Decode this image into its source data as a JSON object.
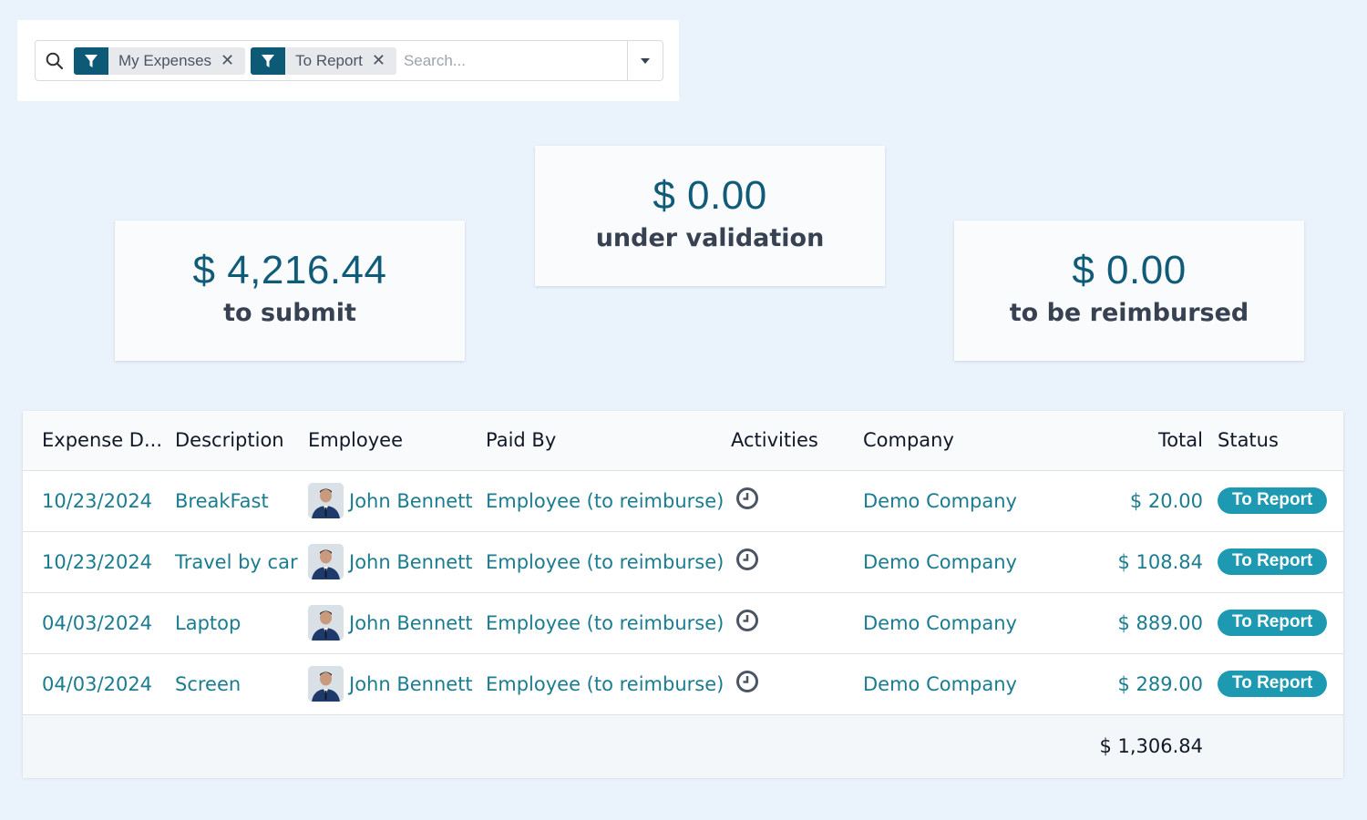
{
  "search": {
    "facets": [
      {
        "icon": "filter-icon",
        "label": "My Expenses"
      },
      {
        "icon": "filter-icon",
        "label": "To Report"
      }
    ],
    "placeholder": "Search...",
    "value": ""
  },
  "summary_cards": [
    {
      "amount": "$ 4,216.44",
      "label": "to submit"
    },
    {
      "amount": "$ 0.00",
      "label": "under validation"
    },
    {
      "amount": "$ 0.00",
      "label": "to be reimbursed"
    }
  ],
  "table": {
    "columns": [
      "Expense D...",
      "Description",
      "Employee",
      "Paid By",
      "Activities",
      "Company",
      "Total",
      "Status"
    ],
    "rows": [
      {
        "date": "10/23/2024",
        "description": "BreakFast",
        "employee": "John Bennett",
        "paid_by": "Employee (to reimburse)",
        "activity_icon": "clock-icon",
        "company": "Demo Company",
        "total": "$ 20.00",
        "status": "To Report"
      },
      {
        "date": "10/23/2024",
        "description": "Travel by car",
        "employee": "John Bennett",
        "paid_by": "Employee (to reimburse)",
        "activity_icon": "clock-icon",
        "company": "Demo Company",
        "total": "$ 108.84",
        "status": "To Report"
      },
      {
        "date": "04/03/2024",
        "description": "Laptop",
        "employee": "John Bennett",
        "paid_by": "Employee (to reimburse)",
        "activity_icon": "clock-icon",
        "company": "Demo Company",
        "total": "$ 889.00",
        "status": "To Report"
      },
      {
        "date": "04/03/2024",
        "description": "Screen",
        "employee": "John Bennett",
        "paid_by": "Employee (to reimburse)",
        "activity_icon": "clock-icon",
        "company": "Demo Company",
        "total": "$ 289.00",
        "status": "To Report"
      }
    ],
    "footer_total": "$ 1,306.84"
  },
  "colors": {
    "accent": "#0d5a76",
    "link": "#1b7c90",
    "status_badge": "#1d9ab2",
    "background": "#eaf2fc"
  }
}
